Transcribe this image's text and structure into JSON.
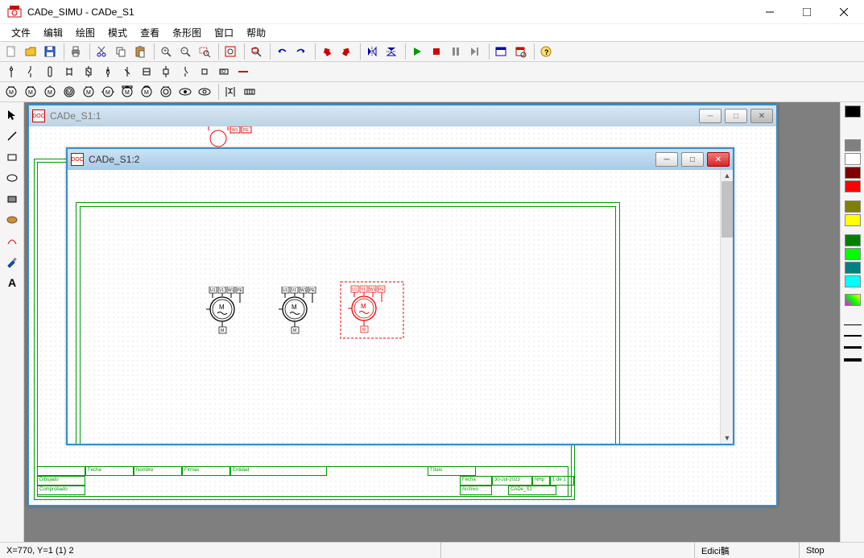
{
  "title": "CADe_SIMU - CADe_S1",
  "menus": [
    "文件",
    "编辑",
    "绘图",
    "模式",
    "查看",
    "条形图",
    "窗口",
    "帮助"
  ],
  "mdi_windows": [
    {
      "title": "CADe_S1:1"
    },
    {
      "title": "CADe_S1:2"
    }
  ],
  "titleblock": {
    "labels": {
      "fecha": "Fecha",
      "nombre": "Nombre",
      "firmas": "Firmas",
      "entidad": "Entidad",
      "dibujado": "Dibujado",
      "comprobado": "Comprobado",
      "titulo": "Título",
      "archivo": "Archivo",
      "nhp": "NHp",
      "page": "1 de 1",
      "date": "30-Jul-2023",
      "file": "CADe_S1"
    }
  },
  "status": {
    "coords": "X=770, Y=1 (1) 2",
    "mode": "Edici髇",
    "sim": "Stop"
  },
  "colors": [
    "#000000",
    "#808080",
    "#ffffff",
    "#800000",
    "#ff0000",
    "#808000",
    "#ffff00",
    "#008000",
    "#00ff00",
    "#008080",
    "#00ffff",
    "#ff66ff"
  ],
  "icons": {
    "doc": "DOC"
  }
}
